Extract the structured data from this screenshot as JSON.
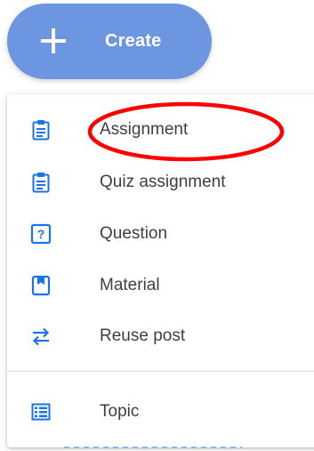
{
  "create_button": {
    "label": "Create",
    "icon": "plus-icon",
    "color": "#6c97e0"
  },
  "menu": {
    "items": [
      {
        "label": "Assignment",
        "icon": "assignment-icon"
      },
      {
        "label": "Quiz assignment",
        "icon": "quiz-assignment-icon"
      },
      {
        "label": "Question",
        "icon": "question-icon"
      },
      {
        "label": "Material",
        "icon": "material-icon"
      },
      {
        "label": "Reuse post",
        "icon": "reuse-post-icon"
      }
    ],
    "topic": {
      "label": "Topic",
      "icon": "topic-icon"
    }
  },
  "colors": {
    "icon_blue": "#1a73e8",
    "annotation_red": "#ff0000",
    "menu_text": "#3c4043"
  }
}
